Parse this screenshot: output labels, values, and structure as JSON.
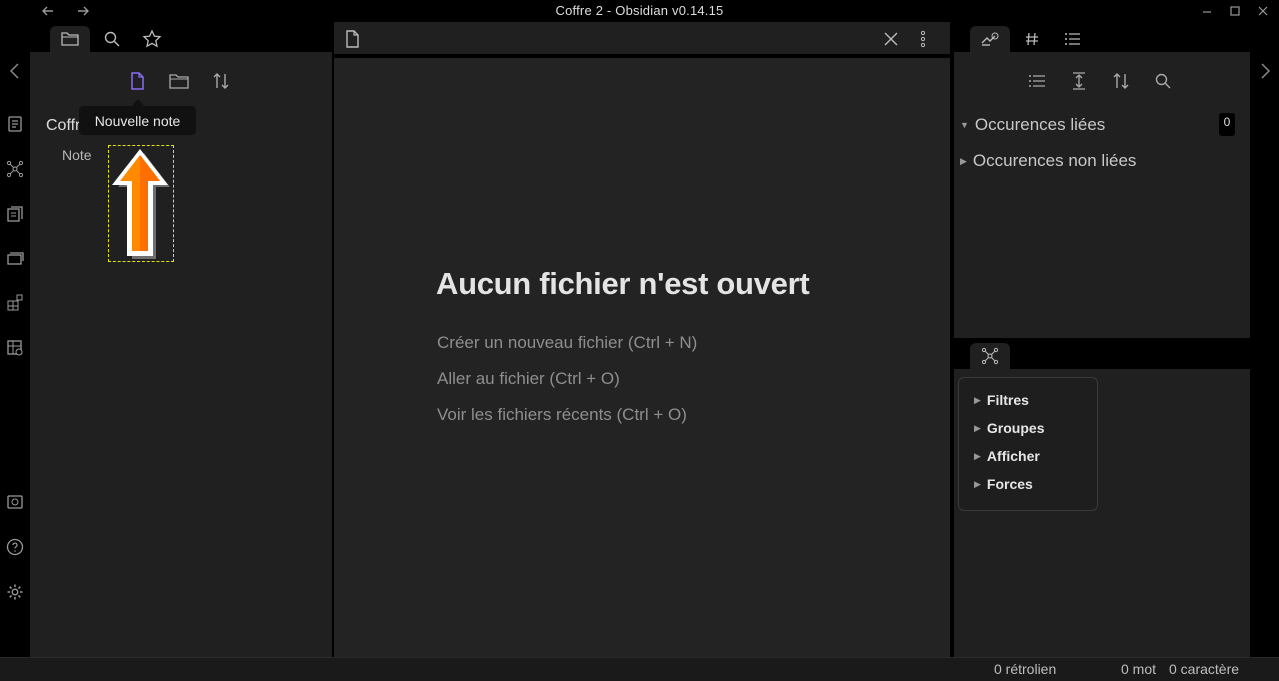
{
  "window": {
    "title": "Coffre 2 - Obsidian v0.14.15"
  },
  "left_pane": {
    "tabs": [
      "file-explorer",
      "search",
      "starred"
    ],
    "vault_name": "Coffre 2",
    "files": [
      {
        "name": "Note"
      }
    ],
    "tooltip": "Nouvelle note"
  },
  "center": {
    "empty_title": "Aucun fichier n'est ouvert",
    "actions": [
      "Créer un nouveau fichier (Ctrl + N)",
      "Aller au fichier (Ctrl + O)",
      "Voir les fichiers récents (Ctrl + O)"
    ]
  },
  "right_pane": {
    "backlinks": {
      "linked_label": "Occurences liées",
      "linked_count": "0",
      "unlinked_label": "Occurences non liées"
    },
    "graph_controls": [
      "Filtres",
      "Groupes",
      "Afficher",
      "Forces"
    ]
  },
  "status_bar": {
    "backlinks": "0 rétrolien",
    "words": "0 mot",
    "chars": "0 caractère"
  },
  "colors": {
    "accent": "#8a6cf0",
    "annotation_arrow": "#ff8a00",
    "selection_box": "#e6e600"
  }
}
